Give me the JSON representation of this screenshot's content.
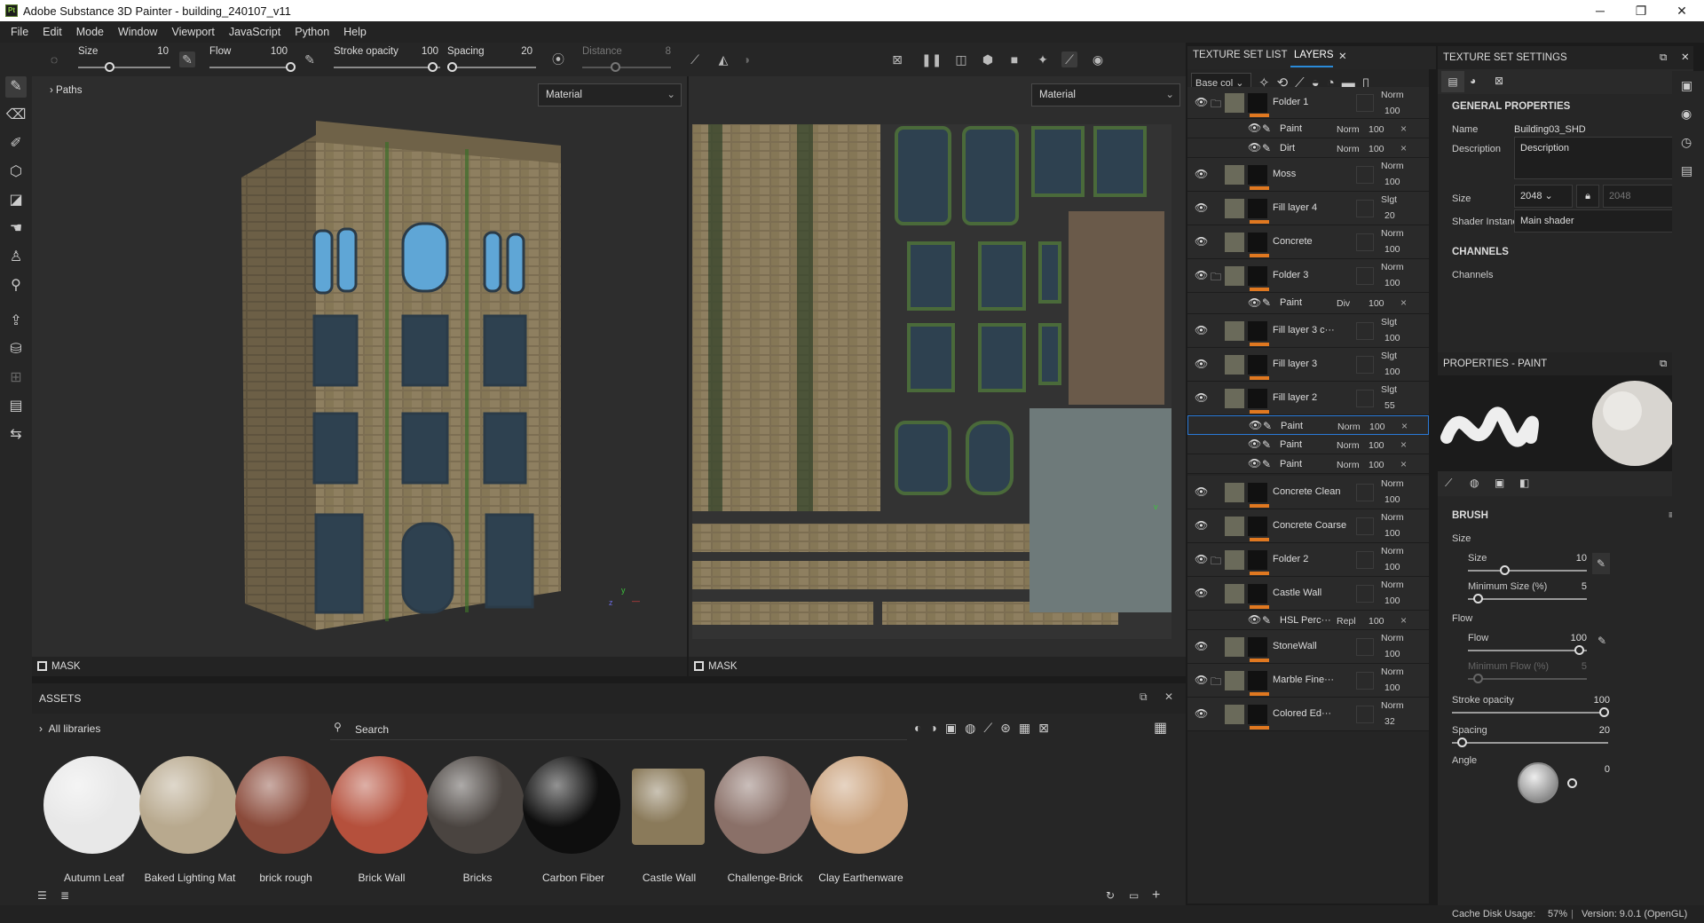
{
  "window": {
    "title": "Adobe Substance 3D Painter - building_240107_v11",
    "app_icon": "Pt",
    "minimize": "─",
    "maximize": "❐",
    "close": "✕"
  },
  "menu": [
    "File",
    "Edit",
    "Mode",
    "Window",
    "Viewport",
    "JavaScript",
    "Python",
    "Help"
  ],
  "toolbar": {
    "size_label": "Size",
    "size_value": "10",
    "flow_label": "Flow",
    "flow_value": "100",
    "stroke_label": "Stroke opacity",
    "stroke_value": "100",
    "spacing_label": "Spacing",
    "spacing_value": "20",
    "distance_label": "Distance",
    "distance_value": "8"
  },
  "viewport3d": {
    "paths_label": "Paths",
    "channel": "Material",
    "mask": "MASK"
  },
  "viewport2d": {
    "channel": "Material",
    "mask": "MASK"
  },
  "assets": {
    "title": "ASSETS",
    "libraries": "All libraries",
    "search_placeholder": "Search",
    "items": [
      {
        "label": "Autumn Leaf",
        "color": "#e8e8e8"
      },
      {
        "label": "Baked Lighting Mat",
        "color": "#b8a98e"
      },
      {
        "label": "brick rough",
        "color": "#8a4a3a"
      },
      {
        "label": "Brick Wall",
        "color": "#b5503c"
      },
      {
        "label": "Bricks",
        "color": "#4a4440"
      },
      {
        "label": "Carbon Fiber",
        "color": "#0e0e0e"
      },
      {
        "label": "Castle Wall",
        "color": "#8a7a5a"
      },
      {
        "label": "Challenge-Brick",
        "color": "#8a7068"
      },
      {
        "label": "Clay Earthenware",
        "color": "#c9a07a"
      }
    ]
  },
  "tabs": {
    "texture_set_list": "TEXTURE SET LIST",
    "layers": "LAYERS"
  },
  "layers_toolbar": {
    "base_color": "Base col"
  },
  "layers": [
    {
      "name": "Folder 1",
      "blend": "Norm",
      "opacity": "100",
      "type": "folder"
    },
    {
      "name": "Paint",
      "blend": "Norm",
      "opacity": "100",
      "type": "sub"
    },
    {
      "name": "Dirt",
      "blend": "Norm",
      "opacity": "100",
      "type": "sub"
    },
    {
      "name": "Moss",
      "blend": "Norm",
      "opacity": "100",
      "type": "fill"
    },
    {
      "name": "Fill layer 4",
      "blend": "Slgt",
      "opacity": "20",
      "type": "fill"
    },
    {
      "name": "Concrete",
      "blend": "Norm",
      "opacity": "100",
      "type": "fill"
    },
    {
      "name": "Folder 3",
      "blend": "Norm",
      "opacity": "100",
      "type": "folder"
    },
    {
      "name": "Paint",
      "blend": "Div",
      "opacity": "100",
      "type": "sub"
    },
    {
      "name": "Fill layer 3 c···",
      "blend": "Slgt",
      "opacity": "100",
      "type": "fill"
    },
    {
      "name": "Fill layer 3",
      "blend": "Slgt",
      "opacity": "100",
      "type": "fill"
    },
    {
      "name": "Fill layer 2",
      "blend": "Slgt",
      "opacity": "55",
      "type": "fill"
    },
    {
      "name": "Paint",
      "blend": "Norm",
      "opacity": "100",
      "type": "sub"
    },
    {
      "name": "Paint",
      "blend": "Norm",
      "opacity": "100",
      "type": "sub"
    },
    {
      "name": "Paint",
      "blend": "Norm",
      "opacity": "100",
      "type": "sub"
    },
    {
      "name": "Concrete Clean",
      "blend": "Norm",
      "opacity": "100",
      "type": "fill"
    },
    {
      "name": "Concrete Coarse",
      "blend": "Norm",
      "opacity": "100",
      "type": "fill"
    },
    {
      "name": "Folder 2",
      "blend": "Norm",
      "opacity": "100",
      "type": "folder"
    },
    {
      "name": "Castle Wall",
      "blend": "Norm",
      "opacity": "100",
      "type": "fill"
    },
    {
      "name": "HSL Perc···",
      "blend": "Repl",
      "opacity": "100",
      "type": "sub"
    },
    {
      "name": "StoneWall",
      "blend": "Norm",
      "opacity": "100",
      "type": "fill"
    },
    {
      "name": "Marble Fine···",
      "blend": "Norm",
      "opacity": "100",
      "type": "folder"
    },
    {
      "name": "Colored Ed···",
      "blend": "Norm",
      "opacity": "32",
      "type": "fill"
    }
  ],
  "texture_set_settings": {
    "title": "TEXTURE SET SETTINGS",
    "general": "GENERAL PROPERTIES",
    "name_label": "Name",
    "name_value": "Building03_SHD",
    "desc_label": "Description",
    "desc_value": "Description",
    "size_label": "Size",
    "size_value": "2048",
    "size_locked": "2048",
    "shader_label": "Shader Instance",
    "shader_value": "Main shader",
    "channels": "CHANNELS",
    "channels_label": "Channels"
  },
  "properties": {
    "title": "PROPERTIES - PAINT",
    "brush": "BRUSH",
    "size_group": "Size",
    "size_label": "Size",
    "size_value": "10",
    "min_size_label": "Minimum Size (%)",
    "min_size_value": "5",
    "flow_group": "Flow",
    "flow_label": "Flow",
    "flow_value": "100",
    "min_flow_label": "Minimum Flow (%)",
    "min_flow_value": "5",
    "stroke_label": "Stroke opacity",
    "stroke_value": "100",
    "spacing_label": "Spacing",
    "spacing_value": "20",
    "angle_label": "Angle",
    "angle_value": "0"
  },
  "status": {
    "cache_label": "Cache Disk Usage:",
    "cache_value": "57%",
    "version": "Version: 9.0.1 (OpenGL)"
  }
}
